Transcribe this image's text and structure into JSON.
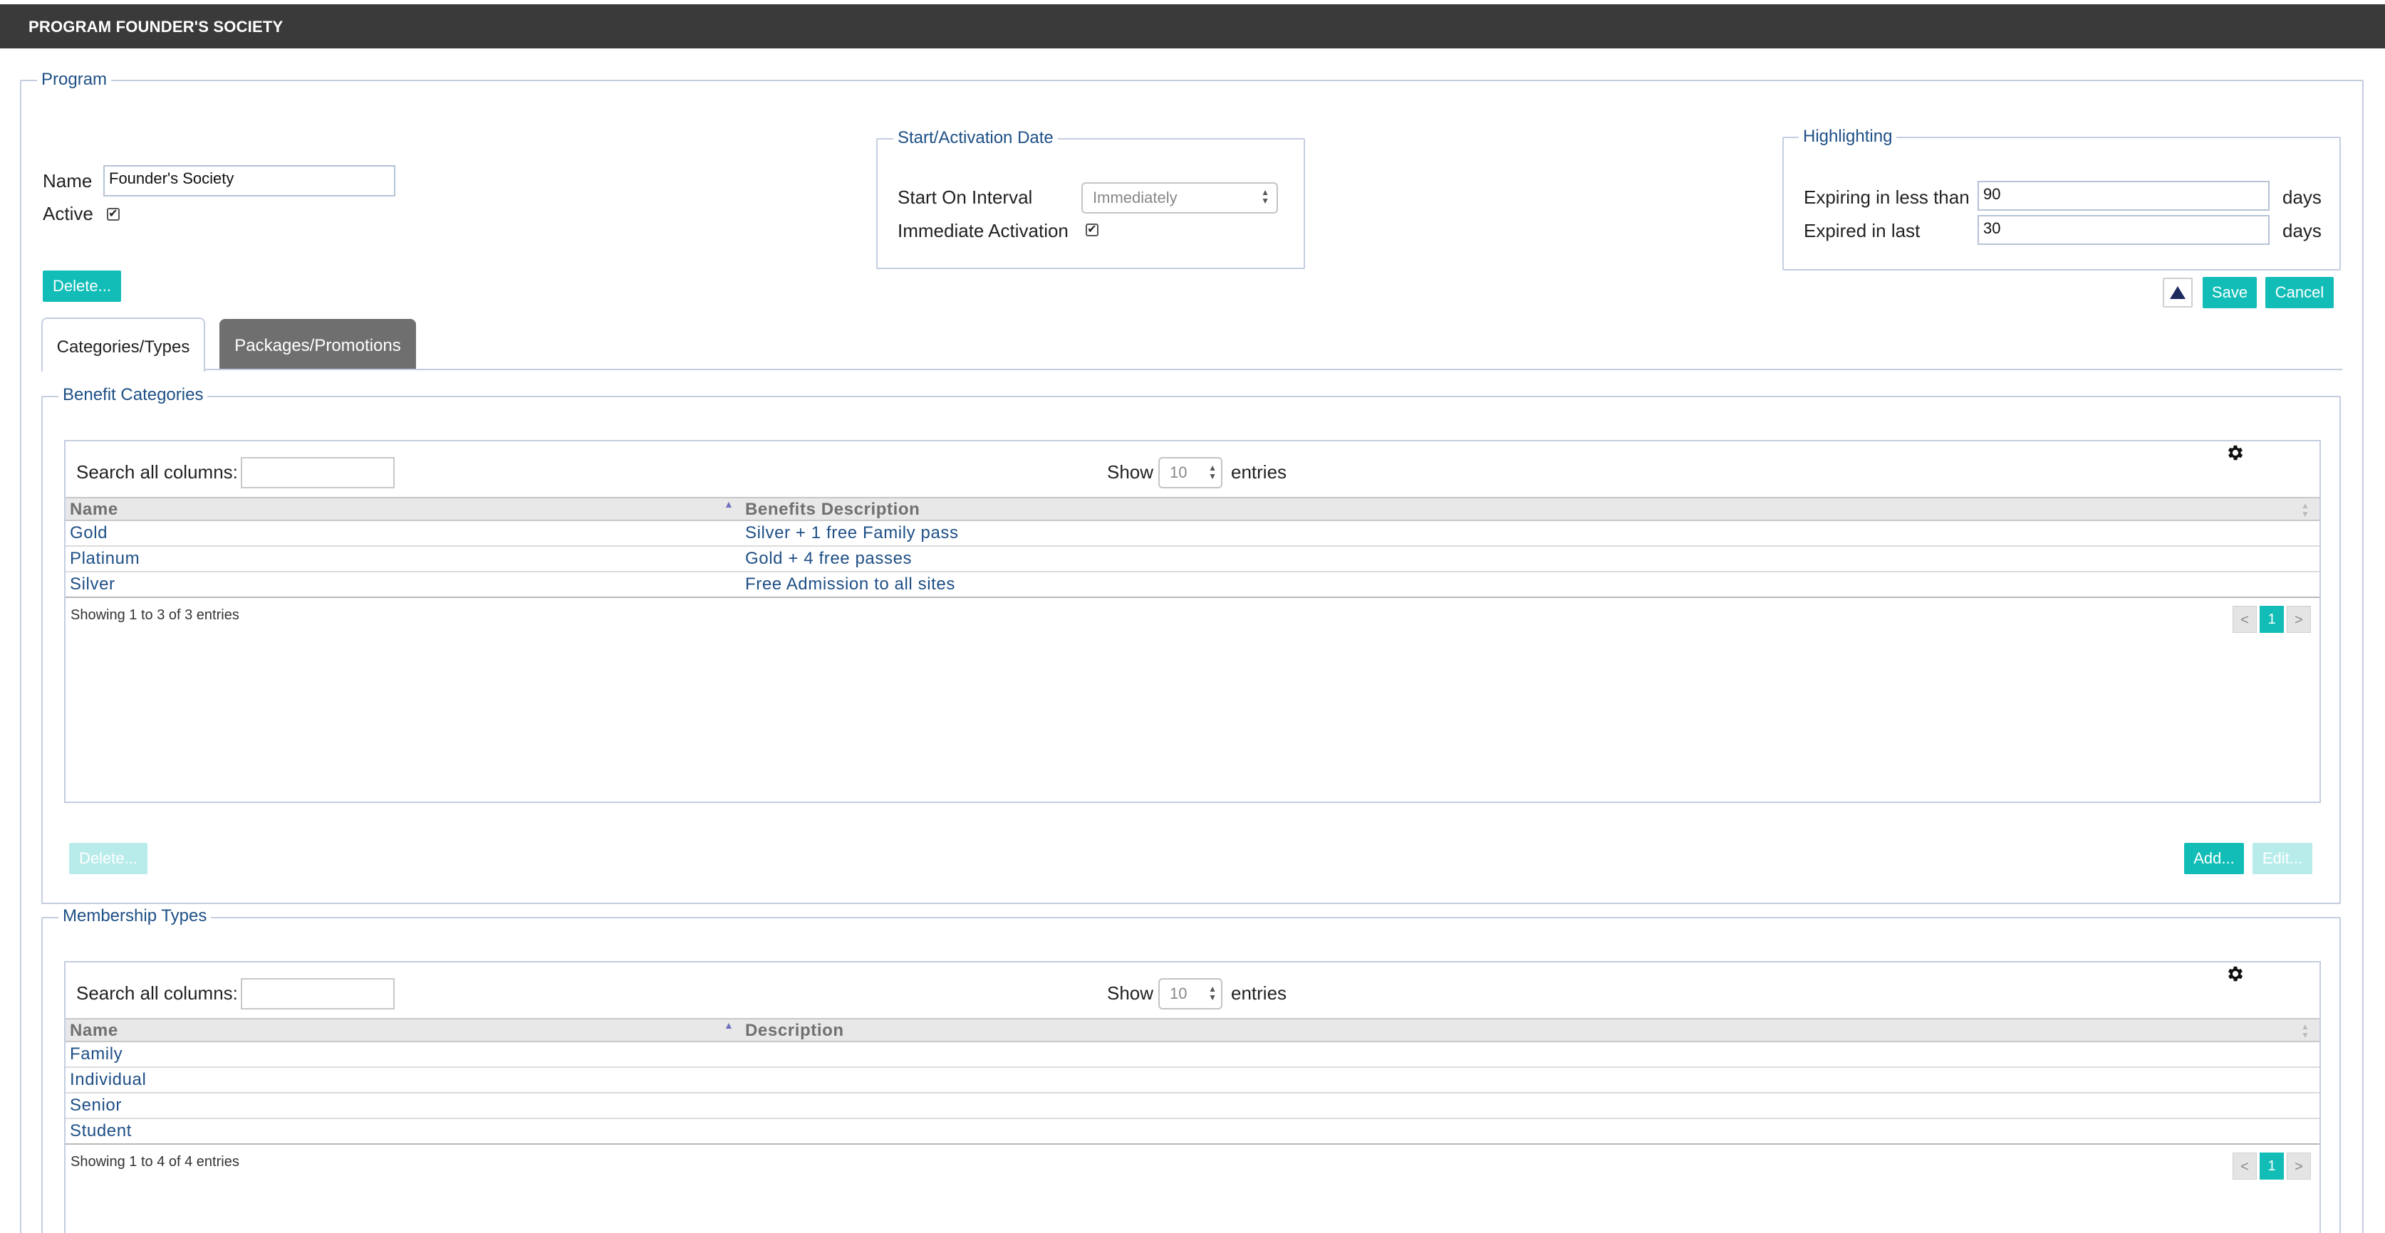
{
  "window": {
    "title": "PROGRAM FOUNDER'S SOCIETY"
  },
  "program": {
    "legend": "Program",
    "name_label": "Name",
    "name_value": "Founder's Society",
    "active_label": "Active",
    "active_checked": true,
    "delete_button": "Delete..."
  },
  "start_activation": {
    "legend": "Start/Activation Date",
    "start_on_interval_label": "Start On Interval",
    "start_on_interval_value": "Immediately",
    "immediate_activation_label": "Immediate Activation",
    "immediate_activation_checked": true
  },
  "highlighting": {
    "legend": "Highlighting",
    "expiring_label": "Expiring in less than",
    "expiring_value": "90",
    "expiring_unit": "days",
    "expired_label": "Expired in last",
    "expired_value": "30",
    "expired_unit": "days"
  },
  "actions": {
    "save": "Save",
    "cancel": "Cancel"
  },
  "tabs": [
    {
      "label": "Categories/Types",
      "active": true
    },
    {
      "label": "Packages/Promotions",
      "active": false
    }
  ],
  "benefit_categories": {
    "legend": "Benefit Categories",
    "search_label": "Search all columns:",
    "search_value": "",
    "show_label": "Show",
    "show_value": "10",
    "entries_label": "entries",
    "columns": [
      "Name",
      "Benefits Description"
    ],
    "rows": [
      [
        "Gold",
        "Silver + 1 free Family pass"
      ],
      [
        "Platinum",
        "Gold + 4 free passes"
      ],
      [
        "Silver",
        "Free Admission to all sites"
      ]
    ],
    "info": "Showing 1 to 3 of 3 entries",
    "pager": {
      "prev": "<",
      "current": "1",
      "next": ">"
    },
    "delete_button": "Delete...",
    "add_button": "Add...",
    "edit_button": "Edit..."
  },
  "membership_types": {
    "legend": "Membership Types",
    "search_label": "Search all columns:",
    "search_value": "",
    "show_label": "Show",
    "show_value": "10",
    "entries_label": "entries",
    "columns": [
      "Name",
      "Description"
    ],
    "rows": [
      [
        "Family",
        ""
      ],
      [
        "Individual",
        ""
      ],
      [
        "Senior",
        ""
      ],
      [
        "Student",
        ""
      ]
    ],
    "info": "Showing 1 to 4 of 4 entries",
    "pager": {
      "prev": "<",
      "current": "1",
      "next": ">"
    }
  },
  "icons": {
    "gear": "gear-icon",
    "collapse": "triangle-up-icon",
    "sort_up": "sort-ascending-icon",
    "sort_both": "sort-both-icon",
    "select_arrows": "select-arrows-icon"
  },
  "colors": {
    "accent": "#12bdb7",
    "titlebar": "#3a3a3a",
    "link": "#1e4f86",
    "border": "#c4cde0"
  }
}
